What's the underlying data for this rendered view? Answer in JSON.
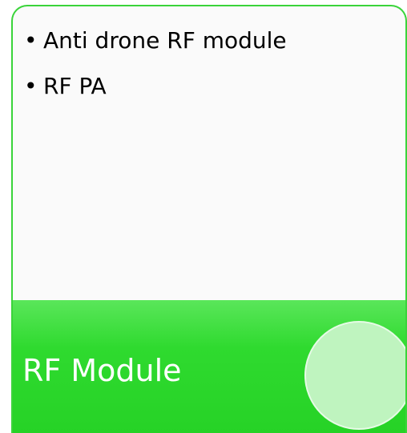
{
  "bullets": [
    {
      "bullet": "•",
      "text": "Anti drone RF module"
    },
    {
      "bullet": "•",
      "text": "RF PA"
    }
  ],
  "footer": {
    "title": "RF Module"
  },
  "colors": {
    "border": "#3ad43a",
    "band": "#2fda2f",
    "circle": "#bff4bf",
    "title_text": "#ffffff"
  }
}
